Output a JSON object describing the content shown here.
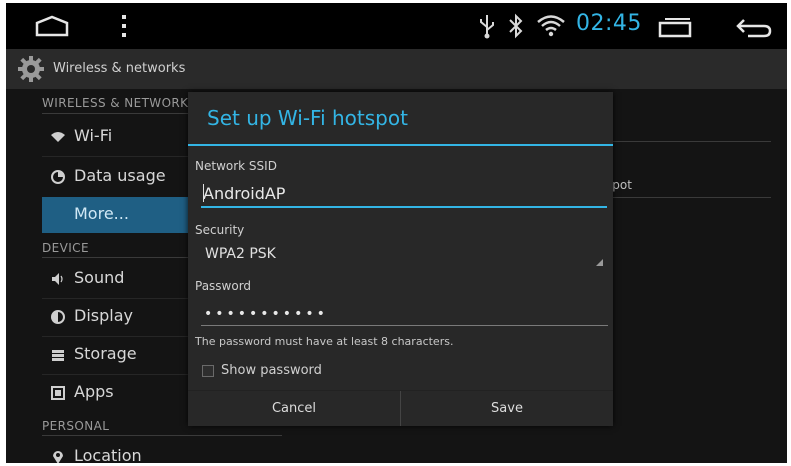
{
  "status_bar": {
    "time": "02:45",
    "accent_color": "#33b5e5",
    "icons": [
      "home-icon",
      "overflow-menu-icon",
      "usb-icon",
      "bluetooth-icon",
      "wifi-signal-icon",
      "recent-apps-icon",
      "back-icon"
    ]
  },
  "action_bar": {
    "title": "Wireless & networks",
    "icon": "settings-gear-icon"
  },
  "left_list": {
    "sections": [
      {
        "title": "WIRELESS & NETWORKS"
      },
      {
        "title": "DEVICE"
      },
      {
        "title": "PERSONAL"
      }
    ],
    "items": [
      {
        "label": "Wi-Fi",
        "icon": "wifi-icon"
      },
      {
        "label": "Data usage",
        "icon": "data-usage-icon"
      },
      {
        "label": "More...",
        "selected": true
      },
      {
        "label": "Sound",
        "icon": "sound-icon"
      },
      {
        "label": "Display",
        "icon": "display-icon"
      },
      {
        "label": "Storage",
        "icon": "storage-icon"
      },
      {
        "label": "Apps",
        "icon": "apps-icon"
      },
      {
        "label": "Location",
        "icon": "location-icon"
      }
    ]
  },
  "right_pane": {
    "partial_text": "spot"
  },
  "dialog": {
    "title": "Set up Wi-Fi hotspot",
    "ssid_label": "Network SSID",
    "ssid_value": "AndroidAP",
    "security_label": "Security",
    "security_value": "WPA2 PSK",
    "password_label": "Password",
    "password_value": "•••••••••••",
    "hint": "The password must have at least 8 characters.",
    "show_password_label": "Show password",
    "show_password_checked": false,
    "cancel_label": "Cancel",
    "save_label": "Save"
  }
}
